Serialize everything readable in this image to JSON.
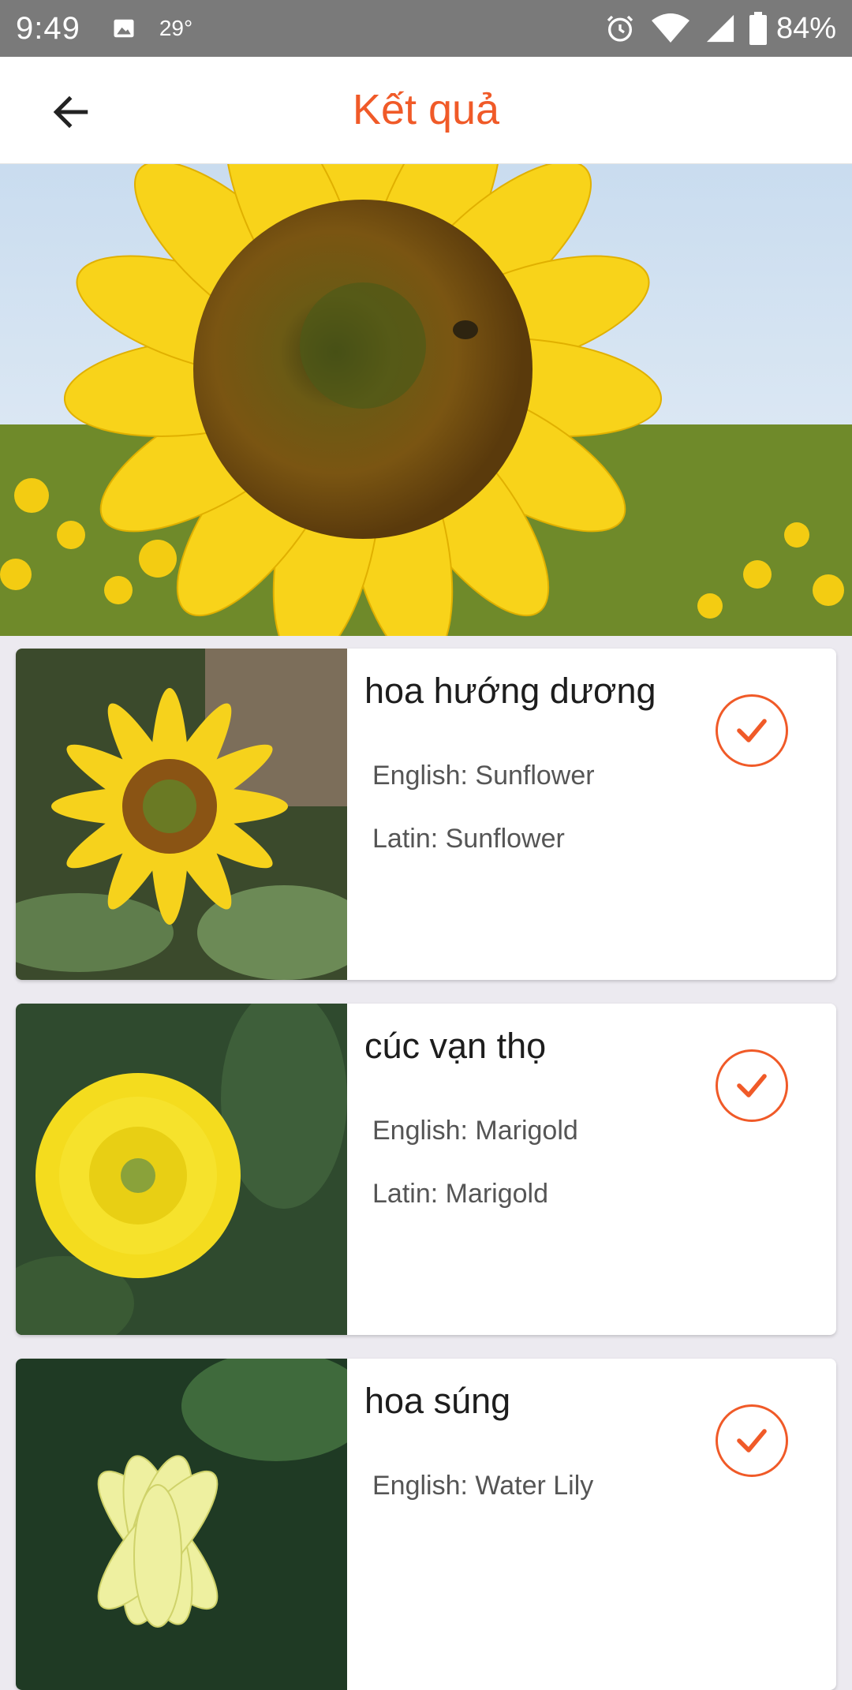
{
  "status_bar": {
    "time": "9:49",
    "temperature": "29°",
    "battery": "84%",
    "icons": [
      "image-icon",
      "alarm-icon",
      "wifi-icon",
      "cellular-icon",
      "battery-icon"
    ]
  },
  "app_bar": {
    "title": "Kết quả",
    "back_icon": "arrow-left-icon"
  },
  "colors": {
    "accent": "#f05a28",
    "status_bar": "#7a7a7a",
    "background": "#eceaf0"
  },
  "hero": {
    "image": "sunflower-photo"
  },
  "results": [
    {
      "name": "hoa hướng dương",
      "english": "English: Sunflower",
      "latin": "Latin: Sunflower",
      "image": "sunflower-thumb"
    },
    {
      "name": "cúc vạn thọ",
      "english": "English: Marigold",
      "latin": "Latin: Marigold",
      "image": "marigold-thumb"
    },
    {
      "name": "hoa súng",
      "english": "English: Water Lily",
      "latin": "",
      "image": "water-lily-thumb"
    }
  ]
}
